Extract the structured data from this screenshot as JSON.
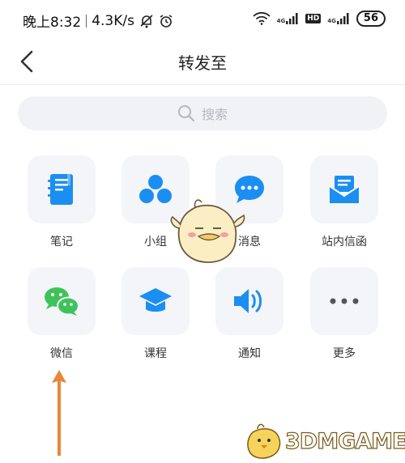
{
  "status_bar": {
    "time": "晚上8:32",
    "speed": "4.3K/s",
    "net1": "4G",
    "hd": "HD",
    "net2": "4G",
    "battery": "56"
  },
  "header": {
    "title": "转发至"
  },
  "search": {
    "placeholder": "搜索"
  },
  "share_targets": [
    {
      "label": "笔记",
      "icon": "notebook-icon"
    },
    {
      "label": "小组",
      "icon": "group-icon"
    },
    {
      "label": "消息",
      "icon": "chat-bubble-icon"
    },
    {
      "label": "站内信函",
      "icon": "mail-icon"
    },
    {
      "label": "微信",
      "icon": "wechat-icon"
    },
    {
      "label": "课程",
      "icon": "graduation-cap-icon"
    },
    {
      "label": "通知",
      "icon": "speaker-icon"
    },
    {
      "label": "更多",
      "icon": "more-dots-icon"
    }
  ],
  "watermark": {
    "text": "3DMGAME"
  },
  "colors": {
    "accent_blue": "#1b8ef2",
    "wechat_green": "#3ec35b",
    "tile_bg": "#f3f5f8",
    "arrow_orange": "#e8863c"
  }
}
